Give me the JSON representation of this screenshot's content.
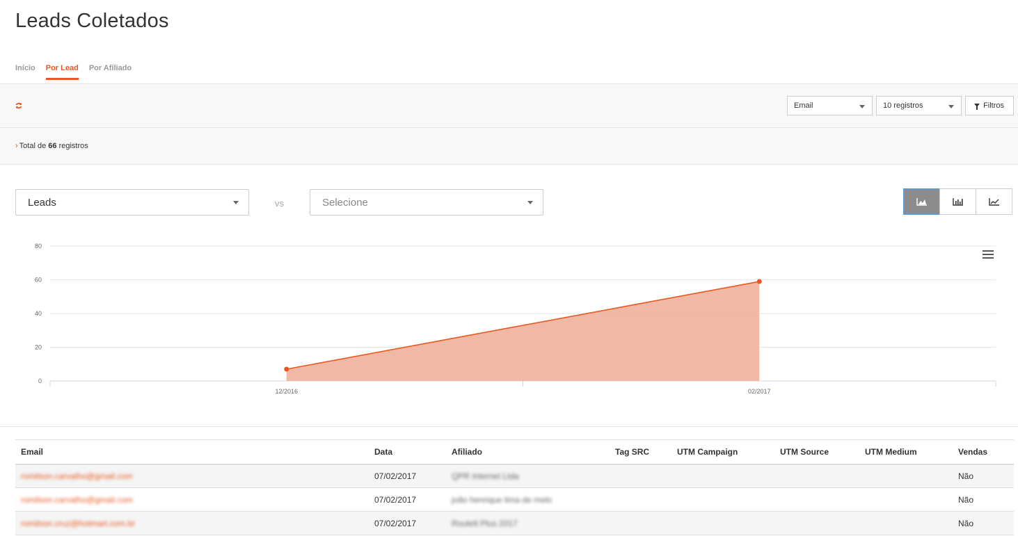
{
  "page": {
    "title": "Leads Coletados"
  },
  "tabs": [
    {
      "label": "Início",
      "active": false
    },
    {
      "label": "Por Lead",
      "active": true
    },
    {
      "label": "Por Afiliado",
      "active": false
    }
  ],
  "toolbar": {
    "field_select": "Email",
    "page_size_select": "10 registros",
    "filter_label": "Filtros"
  },
  "summary": {
    "prefix": "Total de",
    "count": "66",
    "suffix": "registros"
  },
  "chart_controls": {
    "primary_metric": "Leads",
    "vs_label": "vs",
    "secondary_placeholder": "Selecione",
    "view_buttons": [
      {
        "icon": "area-chart-icon",
        "active": true
      },
      {
        "icon": "bar-chart-icon",
        "active": false
      },
      {
        "icon": "line-chart-icon",
        "active": false
      }
    ]
  },
  "colors": {
    "accent": "#e8571e",
    "area_fill": "#f0b4a0",
    "active_button": "#8c8c8c"
  },
  "chart_data": {
    "type": "area",
    "x": [
      "12/2016",
      "02/2017"
    ],
    "series": [
      {
        "values": [
          7,
          59
        ]
      }
    ],
    "ylim": [
      0,
      80
    ],
    "yticks": [
      0,
      20,
      40,
      60,
      80
    ],
    "grid": true,
    "legend": "none"
  },
  "table": {
    "columns": [
      "Email",
      "Data",
      "Afiliado",
      "Tag SRC",
      "UTM Campaign",
      "UTM Source",
      "UTM Medium",
      "Vendas"
    ],
    "rows": [
      [
        "romilson.carvalho@gmail.com",
        "07/02/2017",
        "QPR Internet Ltda",
        "",
        "",
        "",
        "",
        "Não"
      ],
      [
        "romilson.carvalho@gmail.com",
        "07/02/2017",
        "joão henrique lima de melo",
        "",
        "",
        "",
        "",
        "Não"
      ],
      [
        "romilson.cruz@hotmart.com.br",
        "07/02/2017",
        "Roulett Plus 2017",
        "",
        "",
        "",
        "",
        "Não"
      ]
    ]
  }
}
